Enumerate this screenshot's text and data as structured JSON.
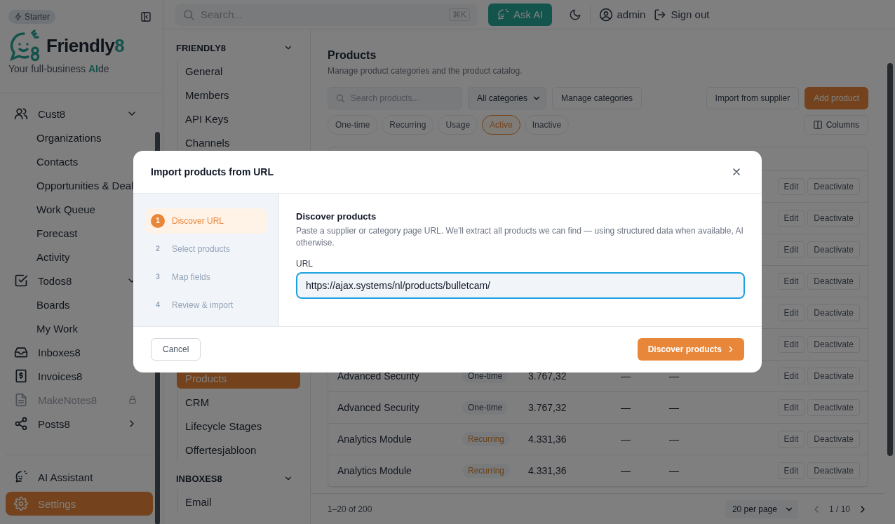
{
  "sidebar": {
    "plan_badge": "Starter",
    "logo": {
      "name": "Friendly",
      "digit": "8"
    },
    "tagline": "Your full-business **AI**de",
    "items": [
      {
        "label": "Cust8",
        "expanded": true,
        "selected": false,
        "children": [
          {
            "label": "Organizations",
            "selected": false
          },
          {
            "label": "Contacts",
            "selected": false
          },
          {
            "label": "Opportunities & Deal",
            "selected": false
          },
          {
            "label": "Work Queue",
            "selected": false
          },
          {
            "label": "Forecast",
            "selected": false
          },
          {
            "label": "Activity",
            "selected": false
          }
        ]
      },
      {
        "label": "Todos8",
        "expanded": true,
        "selected": false,
        "children": [
          {
            "label": "Boards",
            "selected": false
          },
          {
            "label": "My Work",
            "selected": false
          }
        ]
      },
      {
        "label": "Inboxes8",
        "selected": false
      },
      {
        "label": "Invoices8",
        "selected": false
      },
      {
        "label": "MakeNotes8",
        "selected": false,
        "disabled": true
      },
      {
        "label": "Posts8",
        "expanded": false,
        "selected": false
      }
    ],
    "bottom_items": [
      {
        "label": "AI Assistant",
        "selected": false
      },
      {
        "label": "Settings",
        "selected": true
      }
    ]
  },
  "topbar": {
    "search": {
      "placeholder": "Search...",
      "shortcut": "⌘K"
    },
    "ask_ai": "Ask AI",
    "user": "admin",
    "sign_out": "Sign out"
  },
  "settings_nav": [
    {
      "title": "FRIENDLY8",
      "expanded": true,
      "items": [
        {
          "label": "General",
          "selected": false
        },
        {
          "label": "Members",
          "selected": false
        },
        {
          "label": "API Keys",
          "selected": false
        },
        {
          "label": "Channels",
          "selected": false
        }
      ],
      "items_below_dialog": [
        {
          "label": "Products",
          "selected": true
        },
        {
          "label": "CRM",
          "selected": false
        },
        {
          "label": "Lifecycle Stages",
          "selected": false
        },
        {
          "label": "Offertesjabloon",
          "selected": false
        }
      ]
    },
    {
      "title": "INBOXES8",
      "expanded": true,
      "items": [
        {
          "label": "Email",
          "selected": false
        }
      ]
    }
  ],
  "page": {
    "title": "Products",
    "subtitle": "Manage product categories and the product catalog.",
    "search": {
      "placeholder": "Search products..."
    },
    "category_select": "All categories",
    "buttons": [
      {
        "label": "Manage categories",
        "kind": "secondary"
      },
      {
        "label": "Import from supplier",
        "kind": "secondary"
      },
      {
        "label": "Add product",
        "kind": "primary"
      }
    ],
    "filters": [
      {
        "label": "One-time",
        "selected": false
      },
      {
        "label": "Recurring",
        "selected": false
      },
      {
        "label": "Usage",
        "selected": false
      },
      {
        "label": "Active",
        "selected": true
      },
      {
        "label": "Inactive",
        "selected": false
      }
    ],
    "columns_button": "Columns"
  },
  "table": {
    "rows": [
      {
        "actions": [
          "Edit",
          "Deactivate"
        ]
      },
      {
        "actions": [
          "Edit",
          "Deactivate"
        ]
      },
      {
        "actions": [
          "Edit",
          "Deactivate"
        ]
      },
      {
        "actions": [
          "Edit",
          "Deactivate"
        ]
      },
      {
        "actions": [
          "Edit",
          "Deactivate"
        ]
      },
      {
        "actions": [
          "Edit",
          "Deactivate"
        ]
      },
      {
        "name": "Advanced Security",
        "type": {
          "label": "One-time",
          "kind": "one-time"
        },
        "price": "3.767,32",
        "column_4": "—",
        "column_5": "—",
        "actions": [
          "Edit",
          "Deactivate"
        ]
      },
      {
        "name": "Advanced Security",
        "type": {
          "label": "One-time",
          "kind": "one-time"
        },
        "price": "3.767,32",
        "column_4": "—",
        "column_5": "—",
        "actions": [
          "Edit",
          "Deactivate"
        ]
      },
      {
        "name": "Analytics Module",
        "type": {
          "label": "Recurring",
          "kind": "recurring"
        },
        "price": "4.331,36",
        "column_4": "—",
        "column_5": "—",
        "actions": [
          "Edit",
          "Deactivate"
        ]
      },
      {
        "name": "Analytics Module",
        "type": {
          "label": "Recurring",
          "kind": "recurring"
        },
        "price": "4.331,36",
        "column_4": "—",
        "column_5": "—",
        "actions": [
          "Edit",
          "Deactivate"
        ]
      }
    ],
    "footer": {
      "range": "1–20 of 200",
      "per_page": "20 per page",
      "page": "1 / 10"
    }
  },
  "dialog": {
    "title": "Import products from URL",
    "steps": [
      {
        "number": "1",
        "label": "Discover URL",
        "selected": true
      },
      {
        "number": "2",
        "label": "Select products",
        "selected": false
      },
      {
        "number": "3",
        "label": "Map fields",
        "selected": false
      },
      {
        "number": "4",
        "label": "Review & import",
        "selected": false
      }
    ],
    "heading": "Discover products",
    "description": "Paste a supplier or category page URL. We'll extract all products we can find — using structured data when available, AI otherwise.",
    "url_label": "URL",
    "url_value": "https://ajax.systems/nl/products/bulletcam/",
    "cancel": "Cancel",
    "submit": "Discover products"
  }
}
